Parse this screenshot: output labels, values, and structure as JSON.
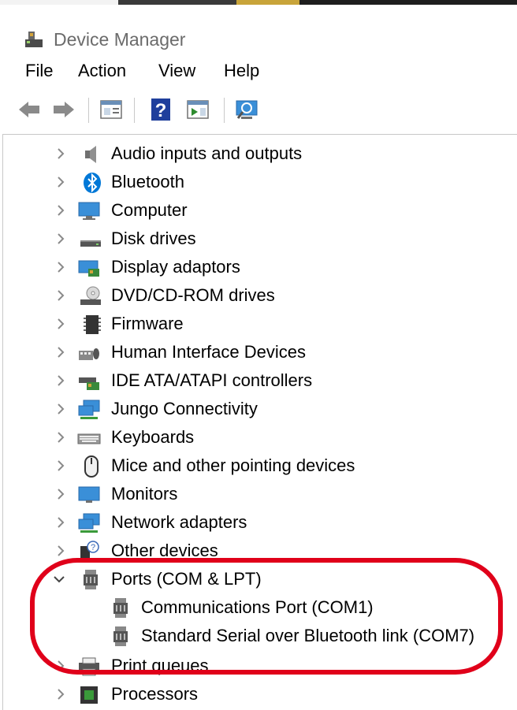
{
  "window": {
    "title": "Device Manager"
  },
  "menu": [
    "File",
    "Action",
    "View",
    "Help"
  ],
  "toolbar": {
    "buttons": [
      "back-arrow-icon",
      "forward-arrow-icon",
      "properties-icon",
      "help-icon",
      "update-driver-icon",
      "scan-hardware-icon"
    ]
  },
  "tree": {
    "categories": [
      {
        "label": "Audio inputs and outputs",
        "icon": "speaker-icon"
      },
      {
        "label": "Bluetooth",
        "icon": "bluetooth-icon"
      },
      {
        "label": "Computer",
        "icon": "computer-icon"
      },
      {
        "label": "Disk drives",
        "icon": "disk-drive-icon"
      },
      {
        "label": "Display adaptors",
        "icon": "display-adapter-icon"
      },
      {
        "label": "DVD/CD-ROM drives",
        "icon": "dvd-drive-icon"
      },
      {
        "label": "Firmware",
        "icon": "firmware-icon"
      },
      {
        "label": "Human Interface Devices",
        "icon": "hid-icon"
      },
      {
        "label": "IDE ATA/ATAPI controllers",
        "icon": "ide-controller-icon"
      },
      {
        "label": "Jungo Connectivity",
        "icon": "network-icon"
      },
      {
        "label": "Keyboards",
        "icon": "keyboard-icon"
      },
      {
        "label": "Mice and other pointing devices",
        "icon": "mouse-icon"
      },
      {
        "label": "Monitors",
        "icon": "monitor-icon"
      },
      {
        "label": "Network adapters",
        "icon": "network-icon"
      },
      {
        "label": "Other devices",
        "icon": "unknown-device-icon"
      }
    ],
    "ports": {
      "label": "Ports (COM & LPT)",
      "icon": "port-icon",
      "children": [
        {
          "label": "Communications Port (COM1)",
          "icon": "port-icon"
        },
        {
          "label": "Standard Serial over Bluetooth link (COM7)",
          "icon": "port-icon"
        }
      ]
    },
    "after": [
      {
        "label": "Print queues",
        "icon": "printer-icon"
      },
      {
        "label": "Processors",
        "icon": "processor-icon"
      }
    ]
  },
  "colors": {
    "highlight": "#e0001a",
    "bluetooth": "#0078d7"
  }
}
